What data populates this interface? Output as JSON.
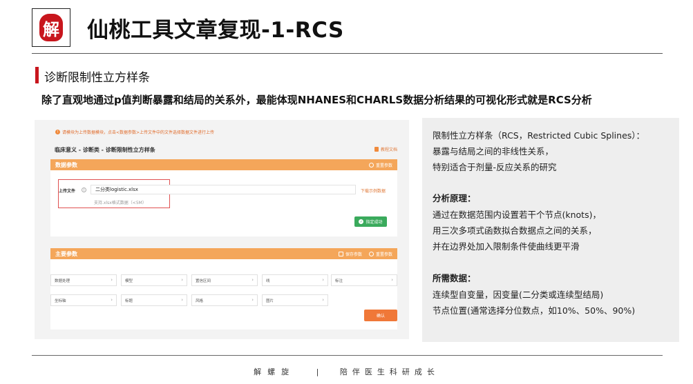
{
  "header": {
    "logo_char": "解",
    "title": "仙桃工具文章复现-1-RCS"
  },
  "section": {
    "title": "诊断限制性立方样条",
    "intro": "除了直观地通过p值判断暴露和结局的关系外，最能体现NHANES和CHARLS数据分析结果的可视化形式就是RCS分析"
  },
  "app": {
    "notice": "请模块为上传数据模块，点击<数据参数>上传文件中的文件选择数据文件进行上传",
    "breadcrumb": "临床意义 - 诊断类 - 诊断限制性立方样条",
    "doc_link": "教程文档",
    "data_card": {
      "title": "数据参数",
      "reset": "重置参数",
      "upload_label": "上传文件",
      "file_name": "二分类logistic.xlsx",
      "hint": "支持.xlsx格式数据（<5M）",
      "sample_link": "下载示例数据",
      "confirm_upload": "指定成功"
    },
    "main_card": {
      "title": "主要参数",
      "save": "保存参数",
      "reset": "重置参数",
      "row1": [
        "数据处理",
        "模型",
        "置信区间",
        "线",
        "标注"
      ],
      "row2": [
        "坐标轴",
        "标题",
        "风格",
        "图片"
      ],
      "confirm": "确认"
    }
  },
  "panel": {
    "def_line1": "限制性立方样条（RCS，Restricted Cubic Splines）：",
    "def_line2": "暴露与结局之间的非线性关系，",
    "def_line3": "特别适合于剂量-反应关系的研究",
    "principle_head": "分析原理：",
    "principle_line1": "通过在数据范围内设置若干个节点(knots)，",
    "principle_line2": "用三次多项式函数拟合数据点之间的关系，",
    "principle_line3": "并在边界处加入限制条件使曲线更平滑",
    "data_head": "所需数据：",
    "data_line1": "连续型自变量，因变量(二分类或连续型结局)",
    "data_line2": "节点位置(通常选择分位数点，如10%、50%、90%)"
  },
  "footer": {
    "left": "解螺旋",
    "sep": "|",
    "right": "陪伴医生科研成长"
  },
  "colors": {
    "brand_red": "#c8161d",
    "app_orange": "#f4a65a",
    "confirm_orange": "#f07838",
    "success_green": "#3aaa5c"
  }
}
